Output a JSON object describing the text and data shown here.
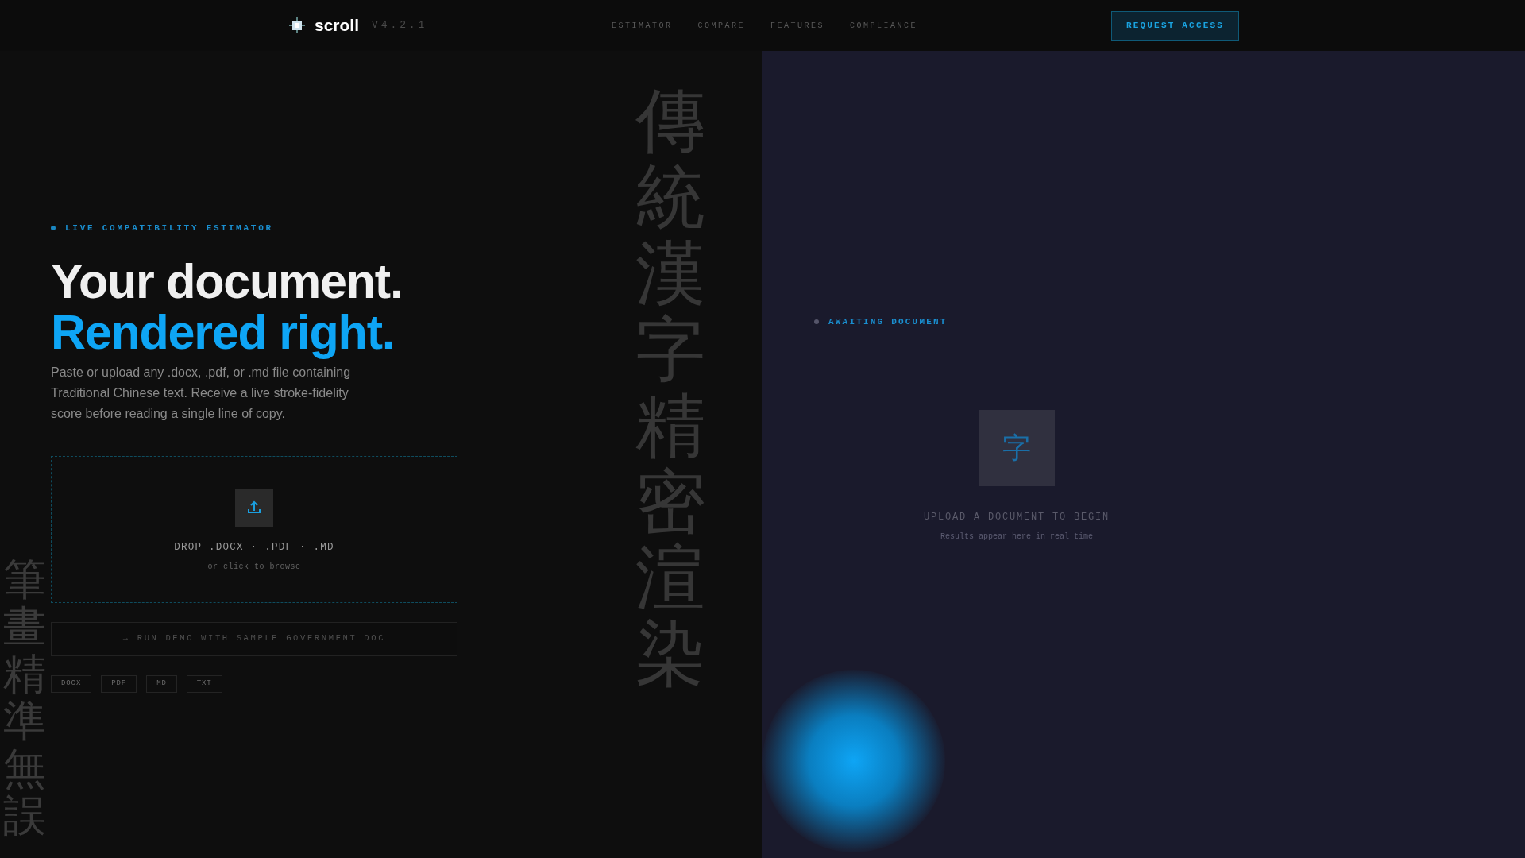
{
  "header": {
    "logo": "scroll",
    "version": "V4.2.1",
    "nav": [
      "ESTIMATOR",
      "COMPARE",
      "FEATURES",
      "COMPLIANCE"
    ],
    "cta": "REQUEST ACCESS"
  },
  "hero": {
    "eyebrow": "LIVE COMPATIBILITY ESTIMATOR",
    "title_line_1": "Your document.",
    "title_line_2": "Rendered right.",
    "description": "Paste or upload any .docx, .pdf, or .md file containing Traditional Chinese text. Receive a live stroke-fidelity score before reading a single line of copy."
  },
  "decor_vertical_right": "傳統漢字精密渲染",
  "decor_vertical_left": "筆畫精準無誤",
  "dropzone": {
    "title": "DROP .DOCX · .PDF · .MD",
    "hint": "or click to browse"
  },
  "demo_button": "→ RUN DEMO WITH SAMPLE GOVERNMENT DOC",
  "formats": [
    "DOCX",
    "PDF",
    "MD",
    "TXT"
  ],
  "result_panel": {
    "status": "AWAITING DOCUMENT",
    "glyph": "字",
    "title": "UPLOAD A DOCUMENT TO BEGIN",
    "subtitle": "Results appear here in real time"
  }
}
